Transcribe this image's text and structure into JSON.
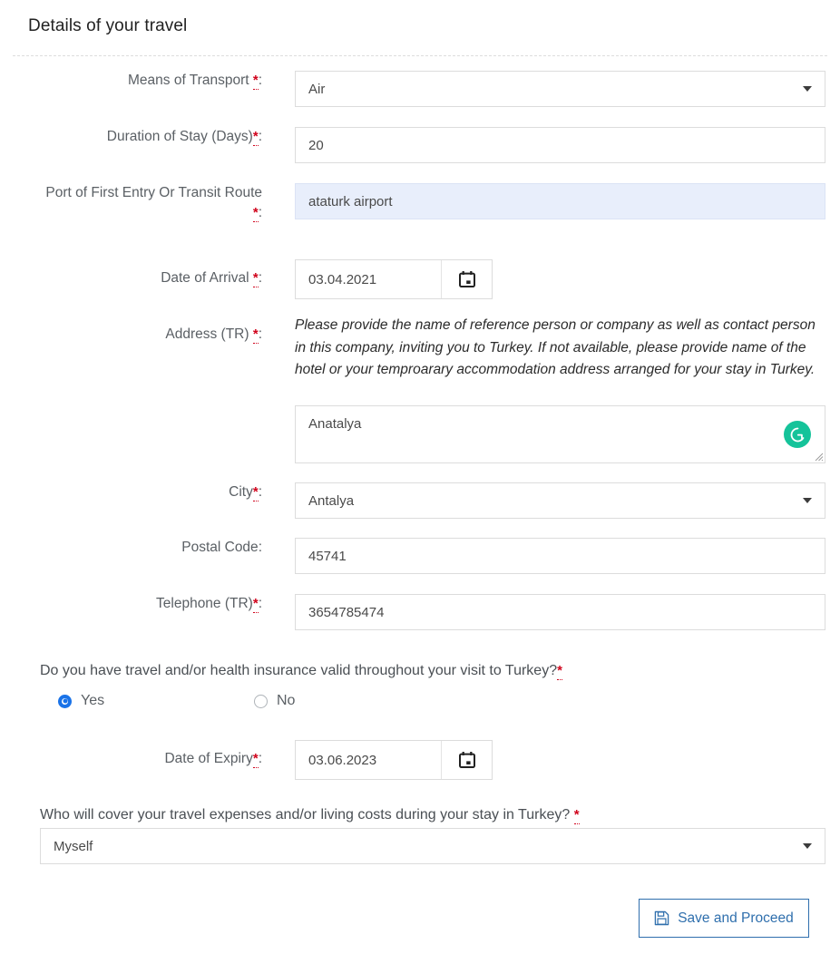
{
  "form": {
    "title": "Details of your travel",
    "required_marker": "*",
    "colon": ":"
  },
  "fields": {
    "means_of_transport": {
      "label": "Means of Transport ",
      "value": "Air",
      "required": true,
      "type": "select"
    },
    "duration_of_stay": {
      "label": "Duration of Stay (Days)",
      "value": "20",
      "required": true,
      "type": "text"
    },
    "port_of_first_entry": {
      "label": "Port of First Entry Or Transit Route",
      "value": "ataturk airport",
      "required": true,
      "type": "text-autofilled"
    },
    "date_of_arrival": {
      "label": "Date of Arrival ",
      "value": "03.04.2021",
      "required": true,
      "type": "date"
    },
    "address_tr": {
      "label": "Address (TR) ",
      "required": true,
      "type": "textarea",
      "help_text": "Please provide the name of reference person or company as well as contact person in this company, inviting you to Turkey. If not available, please provide name of the hotel or your temproarary accommodation address arranged for your stay in Turkey.",
      "value": "Anatalya"
    },
    "city": {
      "label": "City",
      "value": "Antalya",
      "required": true,
      "type": "select"
    },
    "postal_code": {
      "label": "Postal Code",
      "value": "45741",
      "required": false,
      "type": "text"
    },
    "telephone_tr": {
      "label": "Telephone (TR)",
      "value": "3654785474",
      "required": true,
      "type": "text"
    },
    "date_of_expiry": {
      "label": "Date of Expiry",
      "value": "03.06.2023",
      "required": true,
      "type": "date"
    }
  },
  "insurance_question": {
    "text": "Do you have travel and/or health insurance valid throughout your visit to Turkey?",
    "required_marker": "*",
    "options": [
      {
        "label": "Yes",
        "selected": true
      },
      {
        "label": "No",
        "selected": false
      }
    ]
  },
  "expenses_question": {
    "text": "Who will cover your travel expenses and/or living costs during your stay in Turkey? ",
    "required_marker": "*",
    "value": "Myself"
  },
  "actions": {
    "save_label": "Save and Proceed",
    "save_icon": "save-floppy-icon"
  },
  "icons": {
    "calendar": "calendar-icon",
    "caret": "chevron-down-icon",
    "grammarly": "grammarly-icon",
    "resize": "resize-handle-icon"
  },
  "colors": {
    "required_red": "#d0021b",
    "label_gray": "#5b6065",
    "autofill_blue": "#e8eefb",
    "accent_blue": "#2f6fad",
    "radio_blue": "#1a73e8",
    "grammarly_green": "#15c39a",
    "border_gray": "#dcdcdc"
  }
}
